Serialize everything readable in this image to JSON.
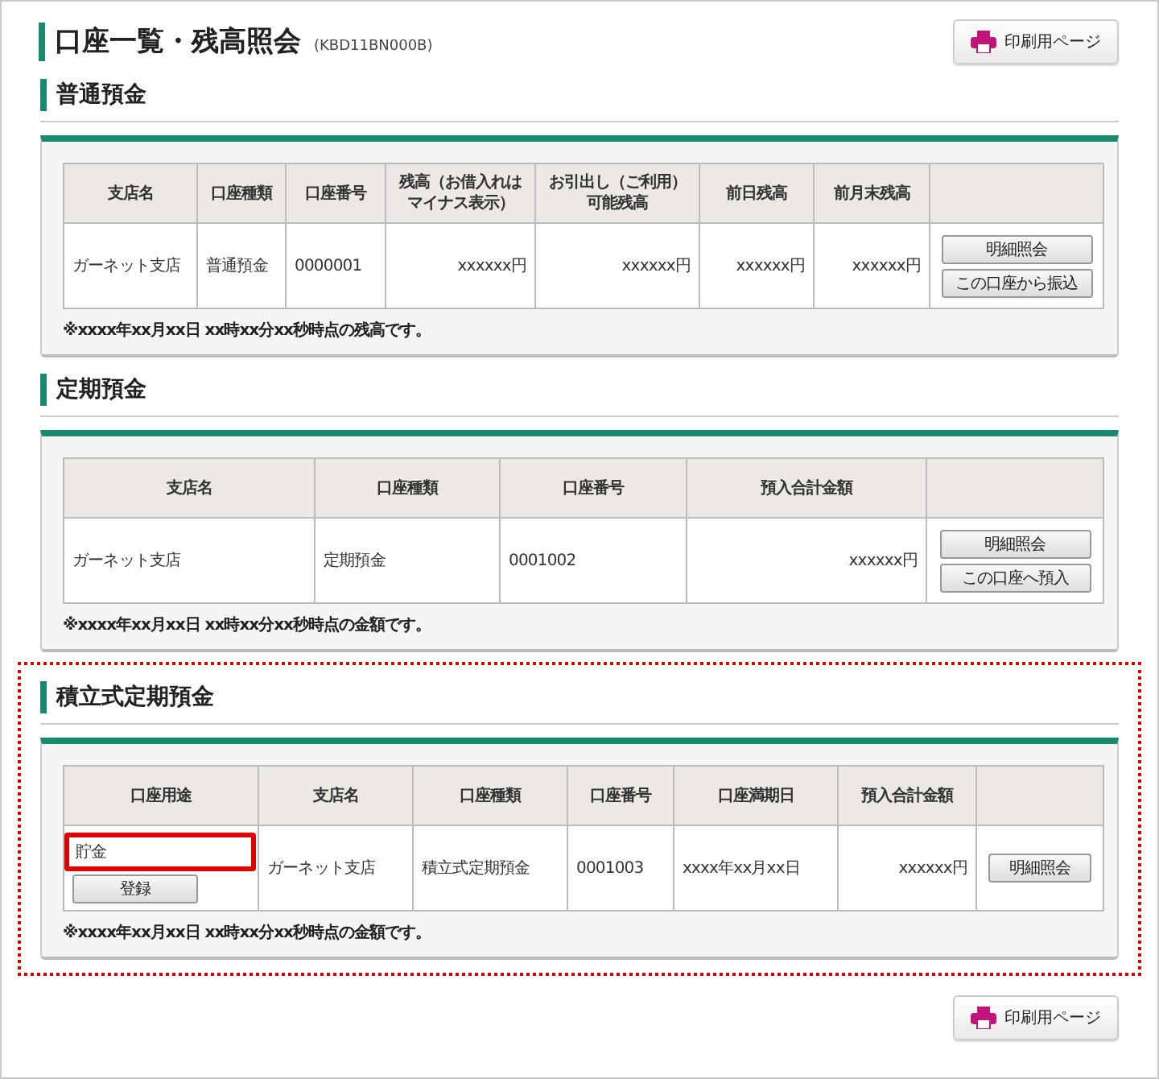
{
  "page": {
    "title": "口座一覧・残高照会",
    "code": "(KBD11BN000B)",
    "print_buttons": [
      "印刷用ページ",
      "印刷用ページ"
    ]
  },
  "sections": [
    {
      "title": "普通預金",
      "highlighted": false,
      "columns": [
        "支店名",
        "口座種類",
        "口座番号",
        "残高（お借入れはマイナス表示）",
        "お引出し（ご利用）可能残高",
        "前日残高",
        "前月末残高",
        ""
      ],
      "rows": [
        [
          {
            "kind": "text",
            "text": "ガーネット支店"
          },
          {
            "kind": "text",
            "text": "普通預金"
          },
          {
            "kind": "text",
            "text": "0000001"
          },
          {
            "kind": "amount",
            "text": "xxxxxx円"
          },
          {
            "kind": "amount",
            "text": "xxxxxx円"
          },
          {
            "kind": "amount",
            "text": "xxxxxx円"
          },
          {
            "kind": "amount",
            "text": "xxxxxx円"
          },
          {
            "kind": "buttons",
            "buttons": [
              "明細照会",
              "この口座から振込"
            ]
          }
        ]
      ],
      "note": "※xxxx年xx月xx日 xx時xx分xx秒時点の残高です。"
    },
    {
      "title": "定期預金",
      "highlighted": false,
      "columns": [
        "支店名",
        "口座種類",
        "口座番号",
        "預入合計金額",
        ""
      ],
      "rows": [
        [
          {
            "kind": "text",
            "text": "ガーネット支店"
          },
          {
            "kind": "text",
            "text": "定期預金"
          },
          {
            "kind": "text",
            "text": "0001002"
          },
          {
            "kind": "amount",
            "text": "xxxxxx円"
          },
          {
            "kind": "buttons",
            "buttons": [
              "明細照会",
              "この口座へ預入"
            ]
          }
        ]
      ],
      "note": "※xxxx年xx月xx日 xx時xx分xx秒時点の金額です。"
    },
    {
      "title": "積立式定期預金",
      "highlighted": true,
      "columns": [
        "口座用途",
        "支店名",
        "口座種類",
        "口座番号",
        "口座満期日",
        "預入合計金額",
        ""
      ],
      "rows": [
        [
          {
            "kind": "usage",
            "text": "貯金",
            "highlighted": true,
            "button": "登録"
          },
          {
            "kind": "text",
            "text": "ガーネット支店"
          },
          {
            "kind": "text",
            "text": "積立式定期預金"
          },
          {
            "kind": "text",
            "text": "0001003"
          },
          {
            "kind": "text",
            "text": "xxxx年xx月xx日"
          },
          {
            "kind": "amount",
            "text": "xxxxxx円"
          },
          {
            "kind": "buttons",
            "buttons": [
              "明細照会"
            ]
          }
        ]
      ],
      "note": "※xxxx年xx月xx日 xx時xx分xx秒時点の金額です。"
    }
  ]
}
